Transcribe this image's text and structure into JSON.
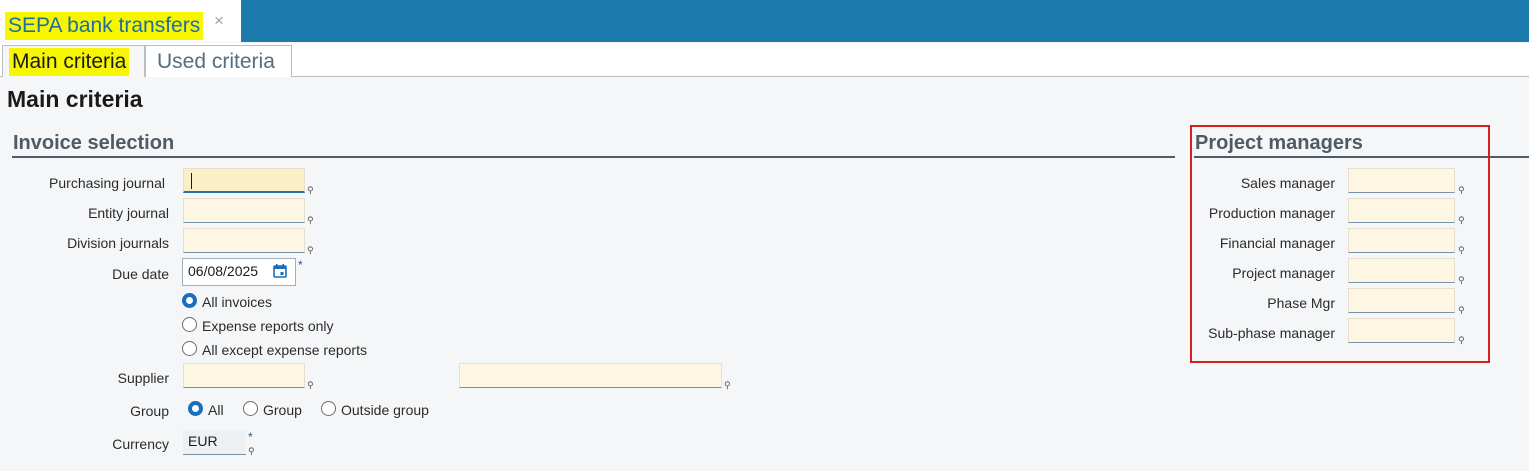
{
  "window": {
    "tab_title": "SEPA bank transfers",
    "close_icon": "close-icon",
    "accent_color": "#1c7aad",
    "highlight_color": "#f6f600"
  },
  "tabs": [
    {
      "label": "Main criteria",
      "active": true
    },
    {
      "label": "Used criteria",
      "active": false
    }
  ],
  "page": {
    "title": "Main criteria"
  },
  "invoice_selection": {
    "title": "Invoice selection",
    "fields": {
      "purchasing_journal": {
        "label": "Purchasing journal",
        "value": ""
      },
      "entity_journal": {
        "label": "Entity journal",
        "value": ""
      },
      "division_journals": {
        "label": "Division journals",
        "value": ""
      },
      "due_date": {
        "label": "Due date",
        "value": "06/08/2025",
        "required_mark": "*",
        "icon": "calendar-icon"
      },
      "supplier": {
        "label": "Supplier",
        "value": "",
        "name_value": ""
      },
      "currency": {
        "label": "Currency",
        "value": "EUR",
        "required_mark": "*"
      }
    },
    "invoice_type": {
      "options": [
        "All invoices",
        "Expense reports only",
        "All except expense reports"
      ],
      "selected": "All invoices"
    },
    "group": {
      "label": "Group",
      "options": [
        "All",
        "Group",
        "Outside group"
      ],
      "selected": "All"
    }
  },
  "project_managers": {
    "title": "Project managers",
    "box_color": "#d42020",
    "fields": [
      {
        "label": "Sales manager",
        "value": ""
      },
      {
        "label": "Production manager",
        "value": ""
      },
      {
        "label": "Financial manager",
        "value": ""
      },
      {
        "label": "Project manager",
        "value": ""
      },
      {
        "label": "Phase Mgr",
        "value": ""
      },
      {
        "label": "Sub-phase manager",
        "value": ""
      }
    ]
  },
  "icons": {
    "pin": "map-pin-icon"
  }
}
